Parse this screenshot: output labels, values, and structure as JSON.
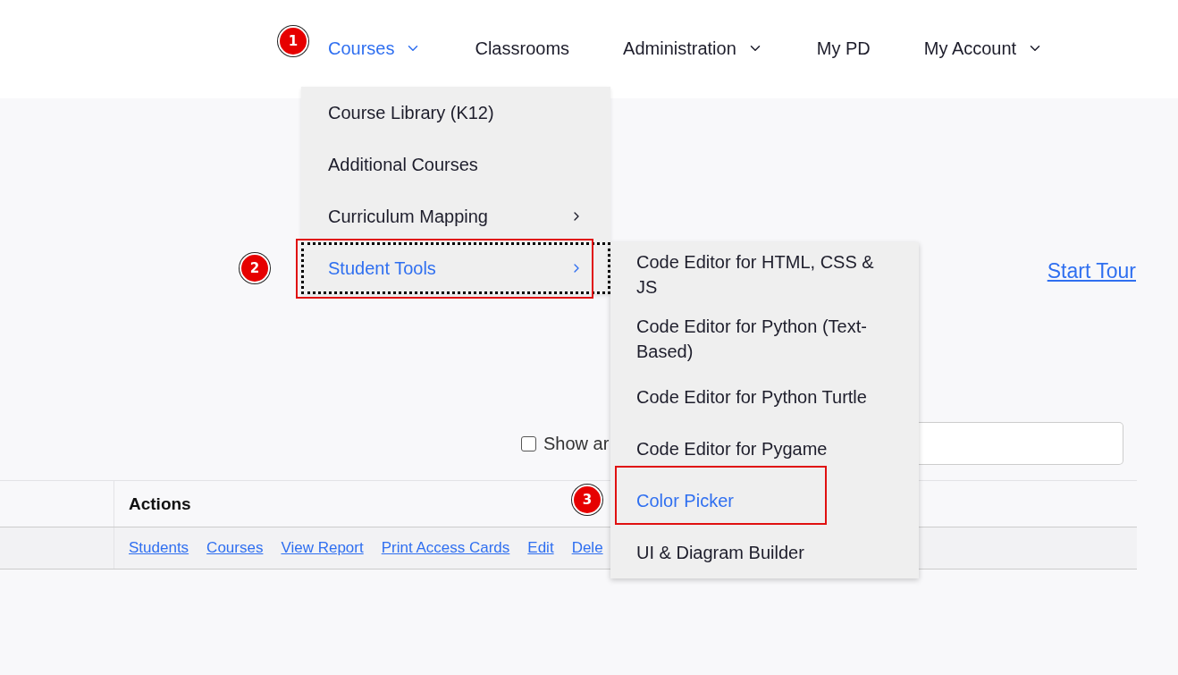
{
  "nav": {
    "items": [
      {
        "label": "Courses",
        "has_dropdown": true,
        "selected": true,
        "step": "1"
      },
      {
        "label": "Classrooms",
        "has_dropdown": false,
        "selected": false
      },
      {
        "label": "Administration",
        "has_dropdown": true,
        "selected": false
      },
      {
        "label": "My PD",
        "has_dropdown": false,
        "selected": false
      },
      {
        "label": "My Account",
        "has_dropdown": true,
        "selected": false
      }
    ]
  },
  "courses_menu": {
    "items": [
      {
        "label": "Course Library (K12)",
        "has_submenu": false,
        "selected": false,
        "highlighted": false,
        "focused": false
      },
      {
        "label": "Additional Courses",
        "has_submenu": false,
        "selected": false,
        "highlighted": false,
        "focused": false
      },
      {
        "label": "Curriculum Mapping",
        "has_submenu": true,
        "selected": false,
        "highlighted": false,
        "focused": false
      },
      {
        "label": "Student Tools",
        "has_submenu": true,
        "selected": true,
        "highlighted": true,
        "focused": true,
        "step": "2"
      }
    ]
  },
  "student_tools_menu": {
    "items": [
      {
        "label": "Code Editor for HTML, CSS & JS",
        "selected": false,
        "highlighted": false
      },
      {
        "label": "Code Editor for Python (Text-Based)",
        "selected": false,
        "highlighted": false
      },
      {
        "label": "Code Editor for Python Turtle",
        "selected": false,
        "highlighted": false
      },
      {
        "label": "Code Editor for Pygame",
        "selected": false,
        "highlighted": false
      },
      {
        "label": "Color Picker",
        "selected": true,
        "highlighted": true,
        "step": "3"
      },
      {
        "label": "UI & Diagram Builder",
        "selected": false,
        "highlighted": false
      }
    ]
  },
  "start_tour": "Start Tour",
  "show_archived": {
    "label": "Show ar",
    "checked": false
  },
  "table": {
    "columns": [
      "Actions"
    ],
    "rows": [
      {
        "actions": [
          "Students",
          "Courses",
          "View Report",
          "Print Access Cards",
          "Edit",
          "Dele"
        ]
      }
    ]
  }
}
